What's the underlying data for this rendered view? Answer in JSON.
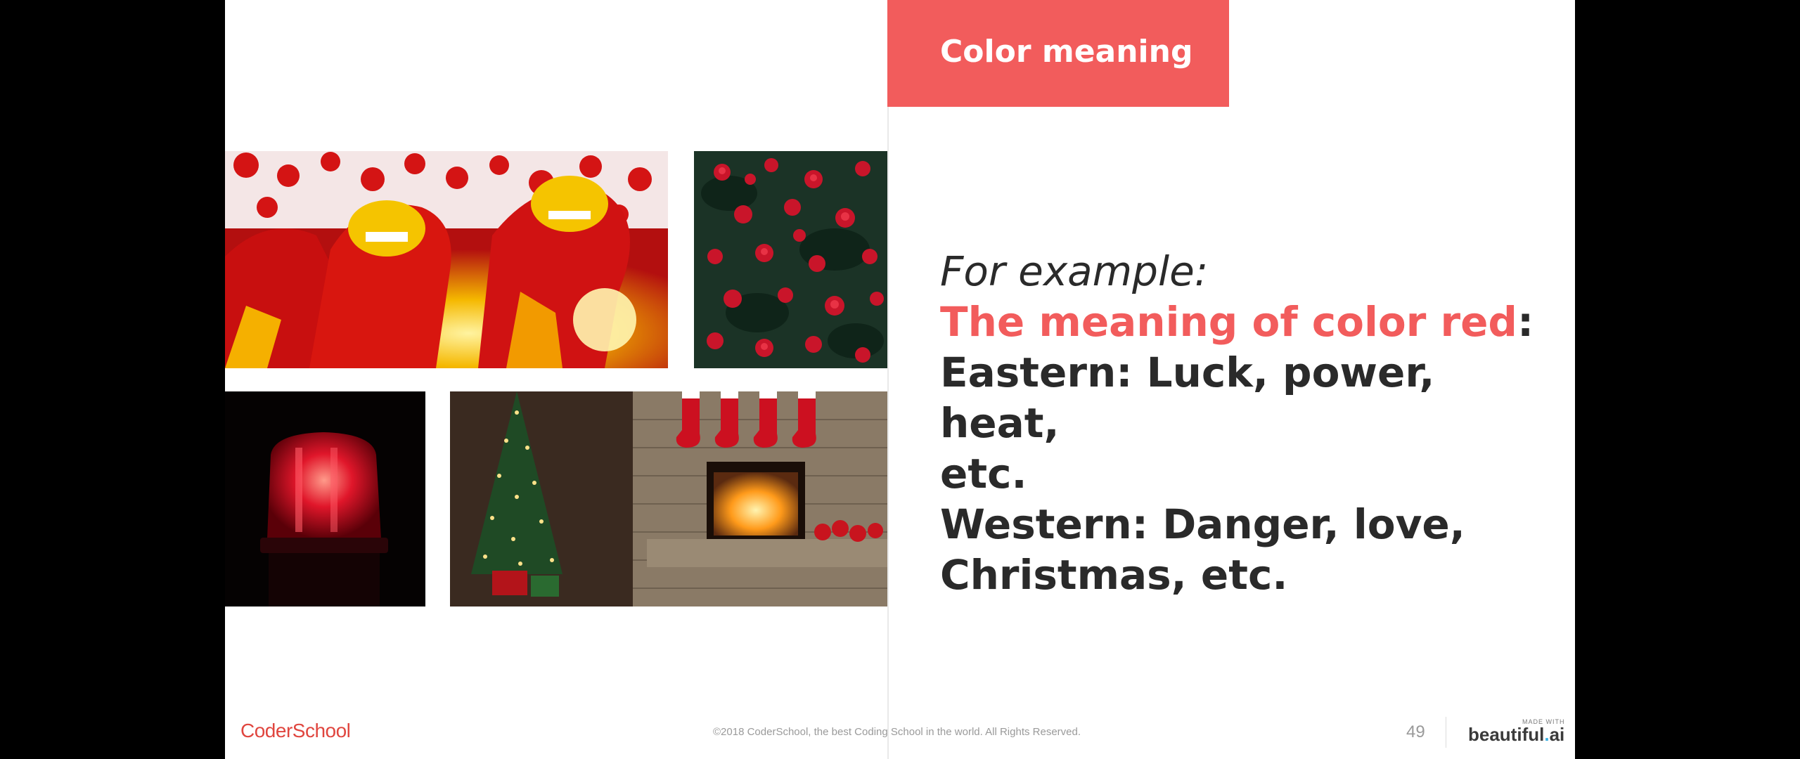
{
  "slide": {
    "title": "Color meaning",
    "body": {
      "intro": "For example:",
      "highlight": "The meaning of color red",
      "highlight_suffix": ":",
      "eastern_line1": "Eastern: Luck, power, heat,",
      "eastern_line2": "etc.",
      "western_line1": "Western: Danger, love,",
      "western_line2": "Christmas, etc."
    },
    "images": [
      {
        "name": "lion-dance-photo"
      },
      {
        "name": "red-roses-photo"
      },
      {
        "name": "red-siren-light-photo"
      },
      {
        "name": "christmas-fireplace-photo"
      }
    ]
  },
  "footer": {
    "logo": "CoderSchool",
    "copyright": "©2018 CoderSchool, the best Coding School in the world. All Rights Reserved.",
    "page_number": "49",
    "made_with": "MADE WITH",
    "brand_main": "beautiful",
    "brand_dot": ".",
    "brand_tail": "ai"
  },
  "colors": {
    "accent": "#f25c5c",
    "text": "#2a2a2a",
    "background": "#ffffff",
    "letterbox": "#000000"
  }
}
